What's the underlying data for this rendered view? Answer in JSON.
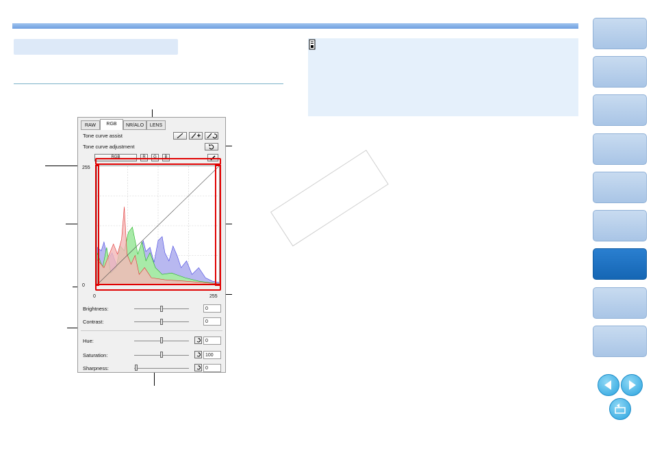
{
  "panel": {
    "tabs": [
      "RAW",
      "RGB",
      "NR/ALO",
      "LENS"
    ],
    "active_tab": "RGB",
    "tone_curve_assist_label": "Tone curve assist",
    "tone_curve_adjustment_label": "Tone curve adjustment",
    "channel_buttons": [
      "RGB",
      "R",
      "G",
      "B"
    ],
    "hist_top_label": "255",
    "hist_bottom_label": "0",
    "axis_left_label": "0",
    "axis_right_label": "255",
    "sliders": [
      {
        "label": "Brightness:",
        "value": "0",
        "reset": false,
        "position": 0.5
      },
      {
        "label": "Contrast:",
        "value": "0",
        "reset": false,
        "position": 0.5
      },
      {
        "label": "Hue:",
        "value": "0",
        "reset": true,
        "position": 0.5
      },
      {
        "label": "Saturation:",
        "value": "100",
        "reset": true,
        "position": 0.5
      },
      {
        "label": "Sharpness:",
        "value": "0",
        "reset": true,
        "position": 0.0
      }
    ]
  },
  "colors": {
    "accent": "#6fa0e0",
    "nav_active": "#1566b4",
    "highlight": "#e00000",
    "hist_red": "#f08080",
    "hist_green": "#80e080",
    "hist_blue": "#8080f0"
  },
  "nav": {
    "button_count": 9,
    "active_index": 6,
    "icons": [
      "prev-arrow-icon",
      "next-arrow-icon",
      "return-icon"
    ]
  }
}
